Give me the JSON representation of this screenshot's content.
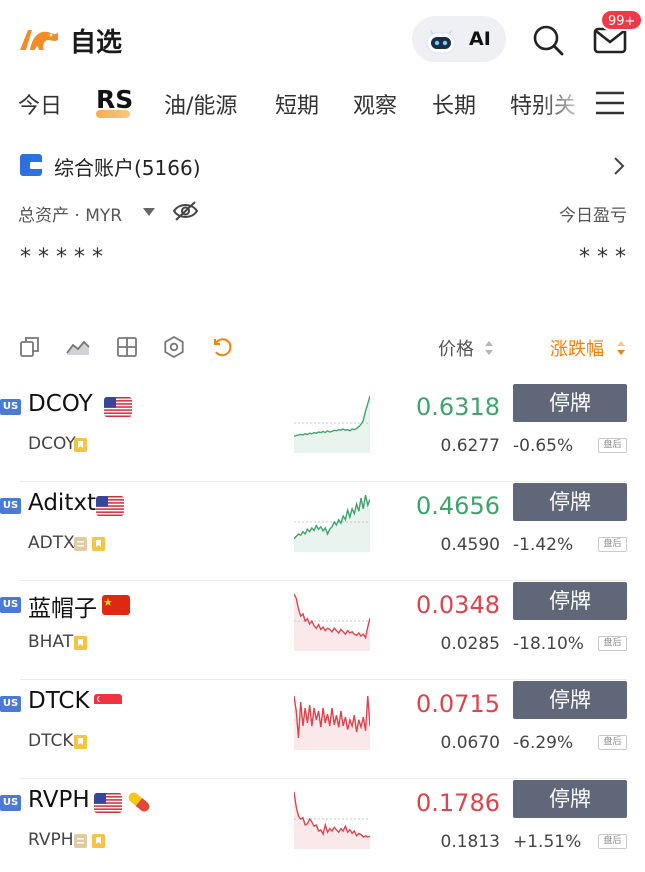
{
  "header": {
    "title": "自选",
    "ai_label": "AI",
    "badge": "99+"
  },
  "tabs": [
    {
      "label": "今日",
      "active": false
    },
    {
      "label": "RS",
      "active": true
    },
    {
      "label": "油/能源",
      "active": false
    },
    {
      "label": "短期",
      "active": false
    },
    {
      "label": "观察",
      "active": false
    },
    {
      "label": "长期",
      "active": false
    },
    {
      "label": "特别关",
      "active": false
    }
  ],
  "account": {
    "name": "综合账户(5166)",
    "asset_label": "总资产 · MYR",
    "pnl_label": "今日盈亏",
    "asset_value": "*****",
    "pnl_value": "***"
  },
  "list_header": {
    "price_label": "价格",
    "change_label": "涨跌幅"
  },
  "colors": {
    "up": "#3fa36b",
    "down": "#d9454f",
    "accent": "#f0820f",
    "halt_button": "#606778",
    "market_badge": "#4b79d6"
  },
  "stocks": [
    {
      "market": "US",
      "name": "DCOY",
      "flag": "us",
      "code": "DCOY",
      "price": "0.6318",
      "direction": "up",
      "prev_price": "0.6277",
      "change_pct": "-0.65%",
      "status": "停牌",
      "session_tag": "盘后",
      "sparkline": [
        0.72,
        0.71,
        0.7,
        0.69,
        0.7,
        0.68,
        0.69,
        0.67,
        0.68,
        0.66,
        0.67,
        0.65,
        0.66,
        0.64,
        0.66,
        0.63,
        0.65,
        0.64,
        0.62,
        0.63,
        0.61,
        0.62,
        0.6,
        0.62,
        0.61,
        0.63,
        0.6,
        0.61,
        0.59,
        0.56,
        0.52,
        0.46,
        0.3,
        0.18,
        0.05
      ]
    },
    {
      "market": "US",
      "name": "Aditxt",
      "flag": "us",
      "code": "ADTX",
      "price": "0.4656",
      "direction": "up",
      "prev_price": "0.4590",
      "change_pct": "-1.42%",
      "status": "停牌",
      "session_tag": "盘后",
      "sparkline": [
        0.78,
        0.74,
        0.7,
        0.72,
        0.66,
        0.7,
        0.62,
        0.66,
        0.6,
        0.64,
        0.56,
        0.62,
        0.58,
        0.65,
        0.6,
        0.7,
        0.62,
        0.58,
        0.5,
        0.55,
        0.46,
        0.52,
        0.4,
        0.46,
        0.3,
        0.42,
        0.28,
        0.36,
        0.2,
        0.32,
        0.1,
        0.28,
        0.05,
        0.22,
        0.12
      ]
    },
    {
      "market": "US",
      "name": "蓝帽子",
      "flag": "cn",
      "code": "BHAT",
      "price": "0.0348",
      "direction": "down",
      "prev_price": "0.0285",
      "change_pct": "-18.10%",
      "status": "停牌",
      "session_tag": "盘后",
      "sparkline": [
        0.05,
        0.12,
        0.3,
        0.42,
        0.38,
        0.5,
        0.46,
        0.55,
        0.5,
        0.58,
        0.62,
        0.56,
        0.64,
        0.6,
        0.66,
        0.62,
        0.64,
        0.68,
        0.62,
        0.66,
        0.7,
        0.64,
        0.68,
        0.72,
        0.66,
        0.7,
        0.68,
        0.72,
        0.74,
        0.7,
        0.75,
        0.72,
        0.78,
        0.6,
        0.45
      ]
    },
    {
      "market": "US",
      "name": "DTCK",
      "flag": "sg",
      "code": "DTCK",
      "price": "0.0715",
      "direction": "down",
      "prev_price": "0.0670",
      "change_pct": "-6.29%",
      "status": "停牌",
      "session_tag": "盘后",
      "sparkline": [
        0.1,
        0.35,
        0.8,
        0.2,
        0.6,
        0.3,
        0.55,
        0.25,
        0.6,
        0.3,
        0.5,
        0.35,
        0.62,
        0.3,
        0.55,
        0.4,
        0.6,
        0.3,
        0.58,
        0.42,
        0.62,
        0.35,
        0.6,
        0.45,
        0.66,
        0.5,
        0.6,
        0.42,
        0.7,
        0.5,
        0.62,
        0.45,
        0.68,
        0.1,
        0.6
      ]
    },
    {
      "market": "US",
      "name": "RVPH",
      "flag": "us",
      "code": "RVPH",
      "price": "0.1786",
      "direction": "down",
      "prev_price": "0.1813",
      "change_pct": "+1.51%",
      "status": "停牌",
      "session_tag": "盘后",
      "sparkline": [
        0.05,
        0.3,
        0.45,
        0.5,
        0.48,
        0.6,
        0.58,
        0.5,
        0.55,
        0.62,
        0.6,
        0.7,
        0.68,
        0.75,
        0.6,
        0.72,
        0.66,
        0.7,
        0.64,
        0.68,
        0.72,
        0.66,
        0.7,
        0.62,
        0.72,
        0.68,
        0.74,
        0.7,
        0.78,
        0.74,
        0.76,
        0.8,
        0.78,
        0.8,
        0.79
      ]
    }
  ]
}
